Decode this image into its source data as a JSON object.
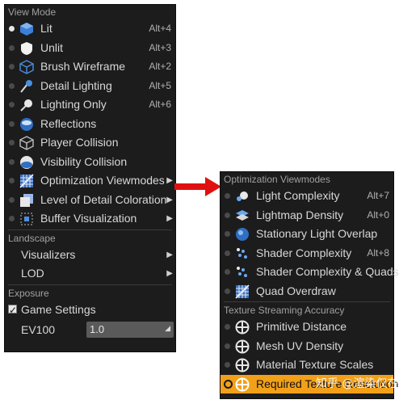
{
  "left_menu": {
    "view_mode_header": "View Mode",
    "view_modes": [
      {
        "label": "Lit",
        "shortcut": "Alt+4",
        "icon": "lit-cube-icon",
        "selected": true
      },
      {
        "label": "Unlit",
        "shortcut": "Alt+3",
        "icon": "unlit-shield-icon",
        "selected": false
      },
      {
        "label": "Brush Wireframe",
        "shortcut": "Alt+2",
        "icon": "wireframe-cube-icon",
        "selected": false
      },
      {
        "label": "Detail Lighting",
        "shortcut": "Alt+5",
        "icon": "detail-lighting-icon",
        "selected": false
      },
      {
        "label": "Lighting Only",
        "shortcut": "Alt+6",
        "icon": "lighting-only-icon",
        "selected": false
      },
      {
        "label": "Reflections",
        "shortcut": "",
        "icon": "reflections-sphere-icon",
        "selected": false
      },
      {
        "label": "Player Collision",
        "shortcut": "",
        "icon": "player-collision-icon",
        "selected": false
      },
      {
        "label": "Visibility Collision",
        "shortcut": "",
        "icon": "visibility-collision-icon",
        "selected": false
      },
      {
        "label": "Optimization Viewmodes",
        "shortcut": "",
        "icon": "optimization-grid-icon",
        "selected": false,
        "submenu": true
      },
      {
        "label": "Level of Detail Coloration",
        "shortcut": "",
        "icon": "lod-coloration-icon",
        "selected": false,
        "submenu": true
      },
      {
        "label": "Buffer Visualization",
        "shortcut": "",
        "icon": "buffer-visualization-icon",
        "selected": false,
        "submenu": true
      }
    ],
    "landscape_header": "Landscape",
    "landscape_items": [
      {
        "label": "Visualizers"
      },
      {
        "label": "LOD"
      }
    ],
    "exposure_header": "Exposure",
    "game_settings_label": "Game Settings",
    "game_settings_checked": true,
    "ev100_label": "EV100",
    "ev100_value": "1.0"
  },
  "right_menu": {
    "optimization_header": "Optimization Viewmodes",
    "optimization_items": [
      {
        "label": "Light Complexity",
        "shortcut": "Alt+7",
        "icon": "light-complexity-icon"
      },
      {
        "label": "Lightmap Density",
        "shortcut": "Alt+0",
        "icon": "lightmap-density-icon"
      },
      {
        "label": "Stationary Light Overlap",
        "shortcut": "",
        "icon": "stationary-light-overlap-icon"
      },
      {
        "label": "Shader Complexity",
        "shortcut": "Alt+8",
        "icon": "shader-complexity-icon"
      },
      {
        "label": "Shader Complexity & Quads",
        "shortcut": "",
        "icon": "shader-complexity-quads-icon"
      },
      {
        "label": "Quad Overdraw",
        "shortcut": "",
        "icon": "quad-overdraw-icon"
      }
    ],
    "texture_header": "Texture Streaming Accuracy",
    "texture_items": [
      {
        "label": "Primitive Distance",
        "icon": "crosshair-circle-icon"
      },
      {
        "label": "Mesh UV Density",
        "icon": "crosshair-circle-icon"
      },
      {
        "label": "Material Texture Scales",
        "icon": "crosshair-circle-icon"
      },
      {
        "label": "Required Texture Resolution",
        "icon": "crosshair-circle-icon",
        "highlighted": true
      }
    ],
    "watermark": "知乎 @渲染仅在者"
  },
  "colors": {
    "menu_bg": "#1c1c1c",
    "text": "#d8d8d8",
    "header": "#a0a0a0",
    "highlight": "#f2a019",
    "arrow": "#e01010"
  }
}
